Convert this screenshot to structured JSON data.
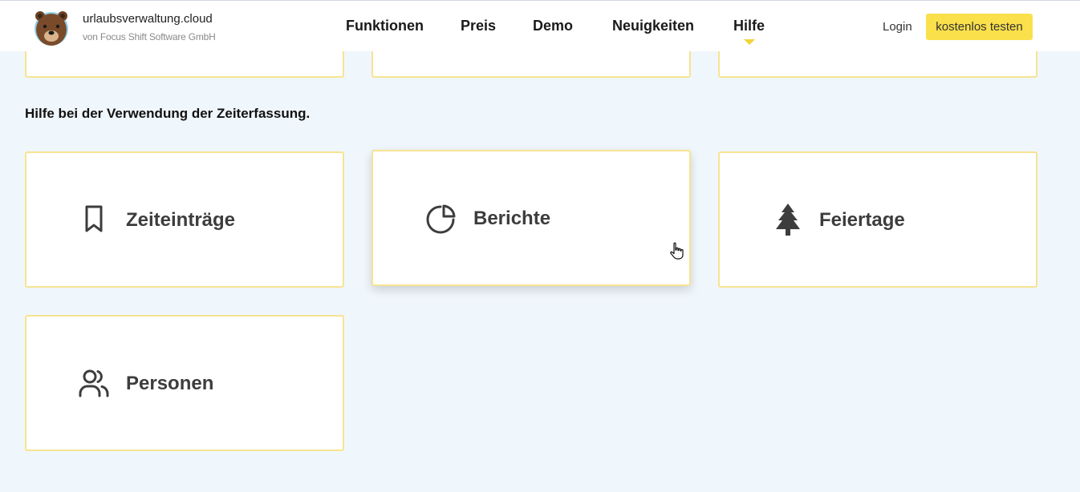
{
  "header": {
    "brand_name": "urlaubsverwaltung.cloud",
    "brand_sub": "von Focus Shift Software GmbH",
    "nav": [
      "Funktionen",
      "Preis",
      "Demo",
      "Neuigkeiten",
      "Hilfe"
    ],
    "active_nav": "Hilfe",
    "login_label": "Login",
    "cta_label": "kostenlos testen"
  },
  "section": {
    "heading": "Hilfe bei der Verwendung der Zeiterfassung."
  },
  "cards": [
    {
      "title": "Zeiteinträge",
      "icon": "bookmark-icon"
    },
    {
      "title": "Berichte",
      "icon": "pie-chart-icon"
    },
    {
      "title": "Feiertage",
      "icon": "tree-icon"
    },
    {
      "title": "Personen",
      "icon": "users-icon"
    }
  ],
  "colors": {
    "accent": "#fae04a",
    "card_border": "#f7e392",
    "background": "#f0f7fc"
  }
}
